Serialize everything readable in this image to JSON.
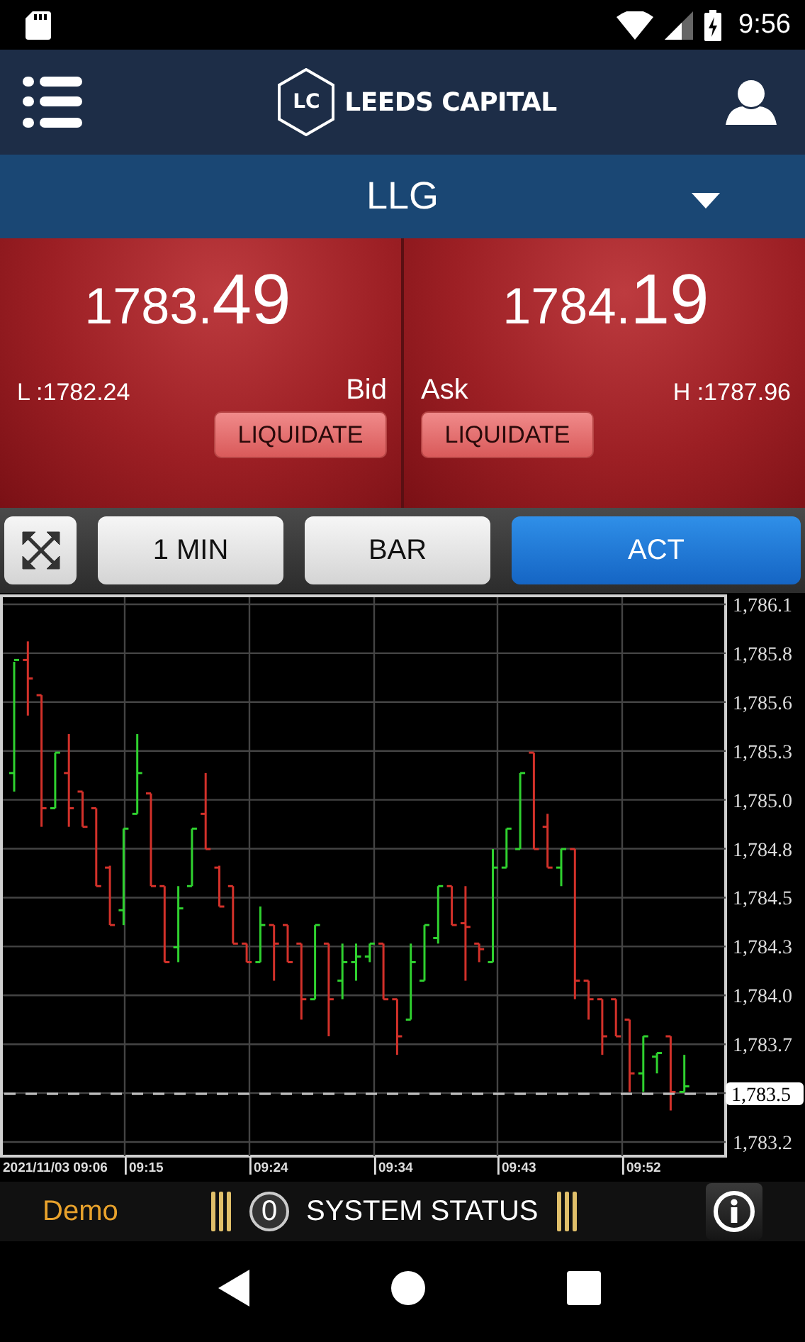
{
  "status_bar": {
    "time": "9:56"
  },
  "header": {
    "logo_mark": "LC",
    "logo_text": "LEEDS CAPITAL"
  },
  "symbol": {
    "name": "LLG"
  },
  "quotes": [
    {
      "kind": "bid",
      "price_main": "1783.",
      "price_pips": "49",
      "side_label": "Bid",
      "range_label": "L :1782.24",
      "button": "LIQUIDATE"
    },
    {
      "kind": "ask",
      "price_main": "1784.",
      "price_pips": "19",
      "side_label": "Ask",
      "range_label": "H :1787.96",
      "button": "LIQUIDATE"
    }
  ],
  "toolbar": {
    "buttons": [
      {
        "label": "1 MIN",
        "selected": false
      },
      {
        "label": "BAR",
        "selected": false
      },
      {
        "label": "ACT",
        "selected": true
      }
    ]
  },
  "price_chart": {
    "y_axis_labels": [
      "1,786.1",
      "1,785.8",
      "1,785.6",
      "1,785.3",
      "1,785.0",
      "1,784.8",
      "1,784.5",
      "1,784.3",
      "1,784.0",
      "1,783.7",
      "1,783.2"
    ],
    "x_axis_labels": [
      "2021/11/03 09:06",
      "09:15",
      "09:24",
      "09:34",
      "09:43",
      "09:52"
    ],
    "last_price": "1,783.5"
  },
  "footer": {
    "mode": "Demo",
    "alert_count": "0",
    "status_label": "SYSTEM STATUS"
  }
}
